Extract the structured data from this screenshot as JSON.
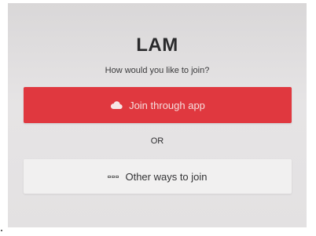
{
  "app": {
    "title": "LAM",
    "prompt": "How would you like to join?"
  },
  "actions": {
    "join_app_label": "Join through app",
    "join_app_icon": "cloud-icon",
    "separator": "OR",
    "other_ways_label": "Other ways to join",
    "other_ways_icon": "more-options-icon"
  },
  "colors": {
    "primary_button": "#e0383f",
    "secondary_button": "#f1f0f0",
    "title_text": "#2a2a2c"
  }
}
